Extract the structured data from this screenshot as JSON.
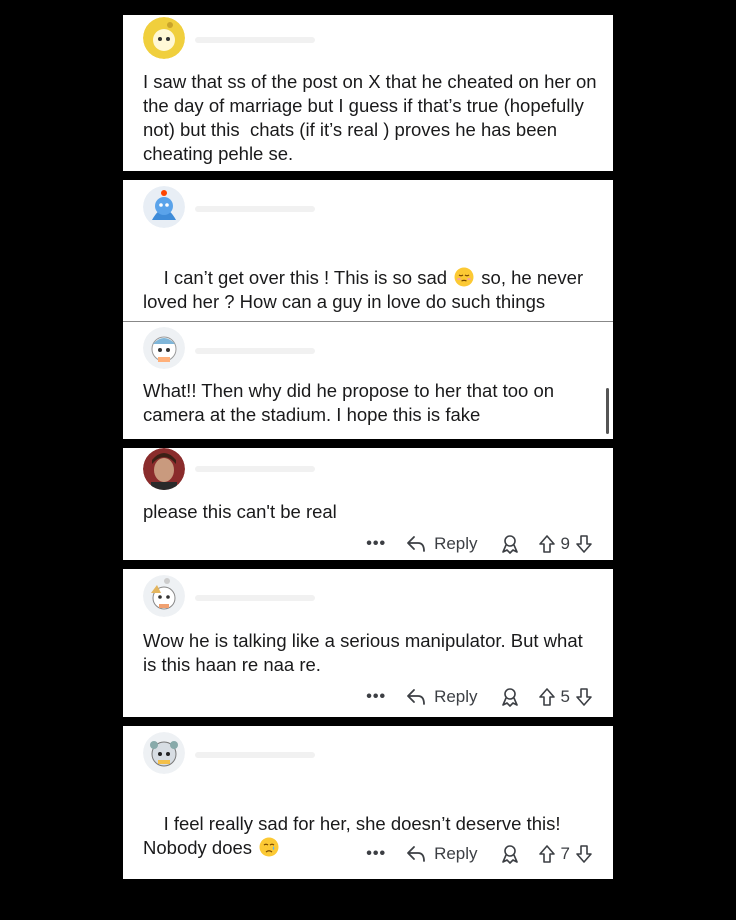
{
  "comments": [
    {
      "text": "I saw that ss of the post on X that he cheated on her on the day of marriage but I guess if that’s true (hopefully not) but this  chats (if it’s real ) proves he has been cheating pehle se."
    },
    {
      "text_before": "I can’t get over this ! This is so sad ",
      "emoji": "pensive-face",
      "text_after": " so, he never loved her ? How can a guy in love do such things"
    },
    {
      "text": "What!! Then why did he propose to her that too on camera at the stadium. I hope this is fake"
    },
    {
      "text": "please this can't be real",
      "more": "•••",
      "reply": "Reply",
      "votes": "9"
    },
    {
      "text": "Wow he is talking like a serious manipulator. But what is this haan re naa re.",
      "more": "•••",
      "reply": "Reply",
      "votes": "5"
    },
    {
      "text_before": "I feel really sad for her, she doesn’t deserve this! Nobody does ",
      "emoji": "crying-face",
      "more": "•••",
      "reply": "Reply",
      "votes": "7"
    }
  ]
}
